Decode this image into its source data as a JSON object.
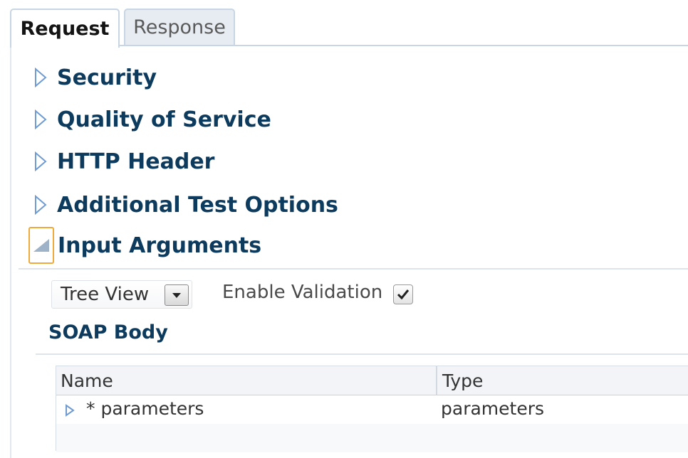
{
  "tabs": [
    {
      "label": "Request",
      "active": true
    },
    {
      "label": "Response",
      "active": false
    }
  ],
  "sections": [
    {
      "label": "Security",
      "expanded": false
    },
    {
      "label": "Quality of Service",
      "expanded": false
    },
    {
      "label": "HTTP Header",
      "expanded": false
    },
    {
      "label": "Additional Test Options",
      "expanded": false
    },
    {
      "label": "Input Arguments",
      "expanded": true
    }
  ],
  "input_arguments": {
    "view_select": {
      "value": "Tree View"
    },
    "validation": {
      "label": "Enable Validation",
      "checked": true
    },
    "soap_body": {
      "heading": "SOAP Body",
      "columns": [
        "Name",
        "Type"
      ],
      "rows": [
        {
          "name": "* parameters",
          "type": "parameters"
        }
      ]
    }
  },
  "colors": {
    "heading": "#0d3b5e",
    "tab_border": "#c7d5e4",
    "focus_outline": "#f0a93b",
    "disclosure": "#6f9bd1"
  },
  "icons": {
    "collapsed": "triangle-right-outline-icon",
    "expanded": "triangle-down-filled-icon",
    "dropdown": "chevron-down-icon",
    "check": "checkmark-icon"
  }
}
